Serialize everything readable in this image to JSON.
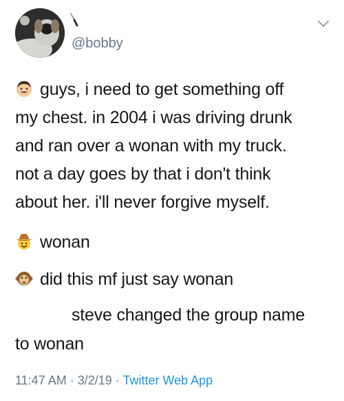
{
  "header": {
    "handle": "@bobby",
    "avatar_icon": "dog-photo-avatar",
    "name_emoji": "kitchen-knife-icon",
    "menu_icon": "chevron-down-icon"
  },
  "tweet": {
    "lines": [
      "guys, i need to get something off",
      "my chest. in 2004 i was driving drunk",
      "and ran over a wonan with my truck.",
      "not a day goes by that i don't think",
      "about her. i'll never forgive myself.",
      "wonan",
      "did this mf just say wonan",
      "steve changed the group name",
      "to wonan"
    ],
    "emojis": [
      "man-face-emoji",
      "cowboy-face-emoji",
      "monkey-face-emoji"
    ]
  },
  "meta": {
    "time": "11:47 AM",
    "separator": " · ",
    "date": "3/2/19",
    "app": "Twitter Web App"
  }
}
